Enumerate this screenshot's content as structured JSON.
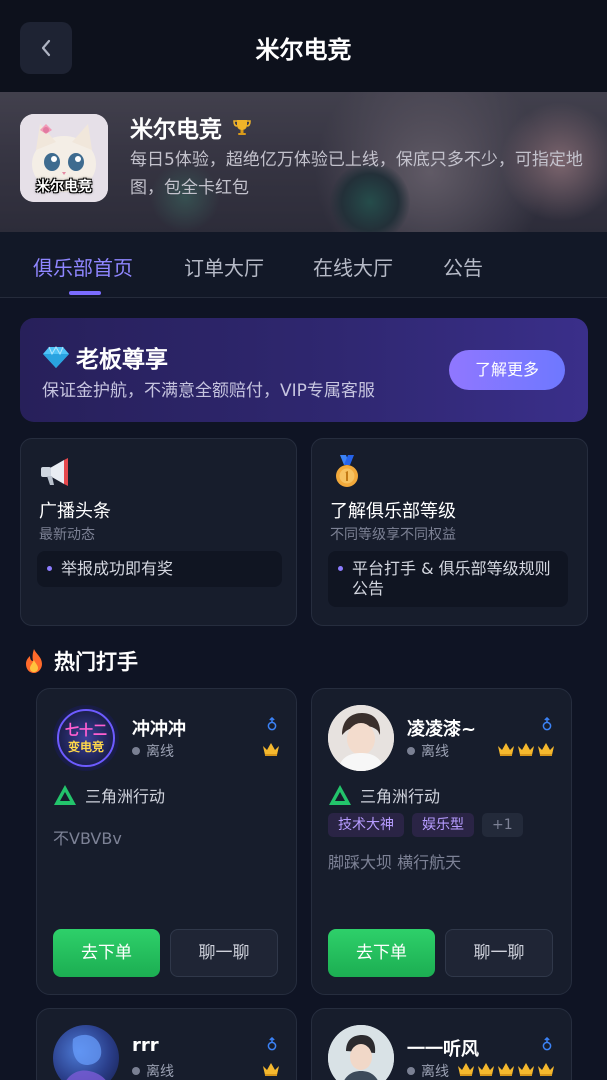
{
  "header": {
    "title": "米尔电竞"
  },
  "club": {
    "name": "米尔电竞",
    "logo_text": "米尔电竞",
    "description": "每日5体验，超绝亿万体验已上线，保底只多不少，可指定地图，包全卡红包"
  },
  "tabs": [
    {
      "label": "俱乐部首页",
      "active": true
    },
    {
      "label": "订单大厅",
      "active": false
    },
    {
      "label": "在线大厅",
      "active": false
    },
    {
      "label": "公告",
      "active": false
    }
  ],
  "vip": {
    "title": "老板尊享",
    "description": "保证金护航，不满意全额赔付，VIP专属客服",
    "button": "了解更多"
  },
  "info_cards": [
    {
      "title": "广播头条",
      "subtitle": "最新动态",
      "item": "举报成功即有奖",
      "icon": "megaphone-icon"
    },
    {
      "title": "了解俱乐部等级",
      "subtitle": "不同等级享不同权益",
      "item": "平台打手 & 俱乐部等级规则公告",
      "icon": "medal-icon"
    }
  ],
  "section": {
    "title": "热门打手"
  },
  "players": [
    {
      "name": "冲冲冲",
      "status": "离线",
      "crowns": 1,
      "game": "三角洲行动",
      "tags": [],
      "bio": "不VBVBv",
      "avatar_text": "七十二变电竞",
      "order_label": "去下单",
      "chat_label": "聊一聊"
    },
    {
      "name": "凌凌漆~",
      "status": "离线",
      "crowns": 3,
      "game": "三角洲行动",
      "tags": [
        "技术大神",
        "娱乐型",
        "+1"
      ],
      "bio": "脚踩大坝 横行航天",
      "order_label": "去下单",
      "chat_label": "聊一聊"
    },
    {
      "name": "rrr",
      "status": "离线",
      "crowns": 1
    },
    {
      "name": "一一听风",
      "status": "离线",
      "crowns": 5
    }
  ],
  "colors": {
    "accent": "#7b6cff",
    "order_button": "#1fb657",
    "background": "#0f1424"
  }
}
